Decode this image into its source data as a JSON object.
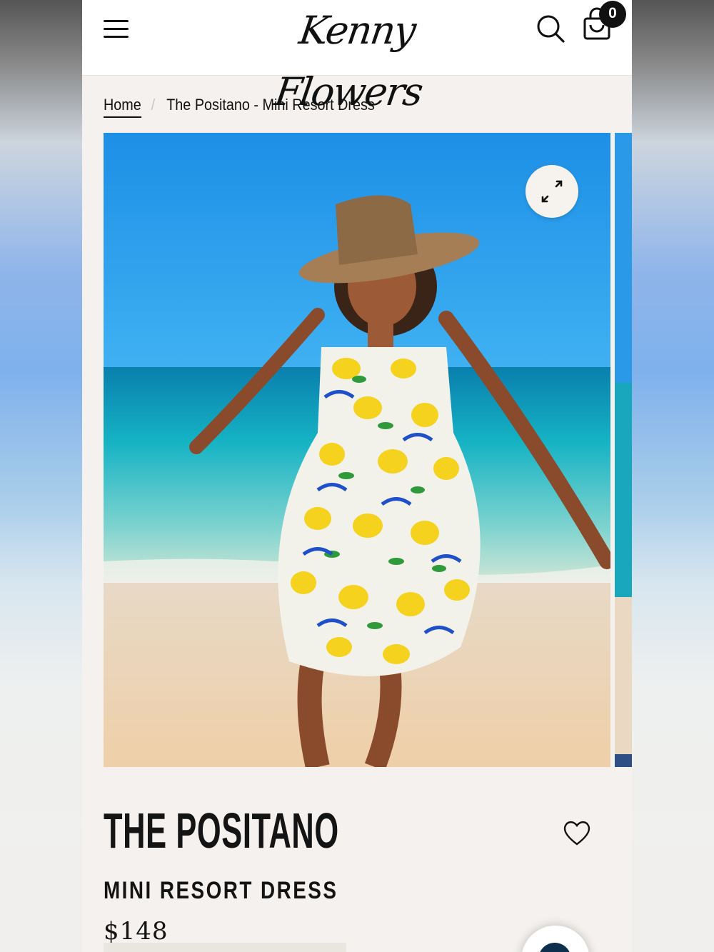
{
  "header": {
    "logo_text": "Kenny Flowers",
    "menu_icon": "hamburger-menu-icon",
    "search_icon": "search-icon",
    "cart_icon": "shopping-bag-icon",
    "cart_count": "0"
  },
  "breadcrumb": {
    "home": "Home",
    "separator": "/",
    "current": "The Positano - Mini Resort Dress"
  },
  "gallery": {
    "expand_icon": "expand-icon"
  },
  "product": {
    "title": "THE POSITANO",
    "subtitle": "MINI RESORT DRESS",
    "price": "$148",
    "wishlist_icon": "heart-icon"
  },
  "chat": {
    "icon": "chat-icon"
  },
  "colors": {
    "page_background": "#f4f1ee",
    "header_background": "#ffffff",
    "text": "#141414",
    "badge": "#111111",
    "chat_accent": "#0e2f4d"
  }
}
